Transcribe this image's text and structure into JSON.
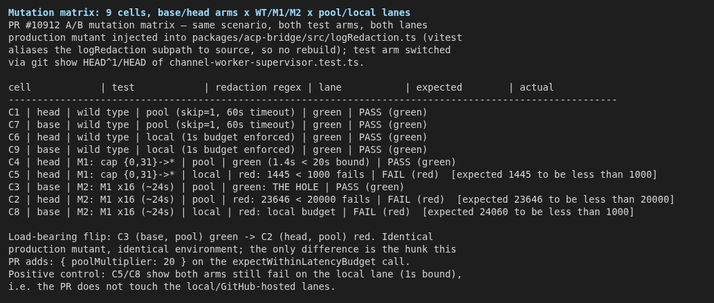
{
  "title": "Mutation matrix: 9 cells, base/head arms x WT/M1/M2 x pool/local lanes",
  "intro": [
    "PR #10912 A/B mutation matrix — same scenario, both test arms, both lanes",
    "production mutant injected into packages/acp-bridge/src/logRedaction.ts (vitest",
    "aliases the logRedaction subpath to source, so no rebuild); test arm switched",
    "via git show HEAD^1/HEAD of channel-worker-supervisor.test.ts."
  ],
  "table": {
    "header": "cell            | test            | redaction regex | lane           | expected        | actual",
    "separator": "----------------------------------------------------------------------------------------------------------",
    "rows": [
      "C1 | head | wild type | pool (skip=1, 60s timeout) | green | PASS (green)",
      "C7 | base | wild type | pool (skip=1, 60s timeout) | green | PASS (green)",
      "C6 | head | wild type | local (1s budget enforced) | green | PASS (green)",
      "C9 | base | wild type | local (1s budget enforced) | green | PASS (green)",
      "C4 | head | M1: cap {0,31}->* | pool | green (1.4s < 20s bound) | PASS (green)",
      "C5 | head | M1: cap {0,31}->* | local | red: 1445 < 1000 fails | FAIL (red)  [expected 1445 to be less than 1000]",
      "C3 | base | M2: M1 x16 (~24s) | pool | green: THE HOLE | PASS (green)",
      "C2 | head | M2: M1 x16 (~24s) | pool | red: 23646 < 20000 fails | FAIL (red)  [expected 23646 to be less than 20000]",
      "C8 | base | M2: M1 x16 (~24s) | local | red: local budget | FAIL (red)  [expected 24060 to be less than 1000]"
    ]
  },
  "conclusion": [
    "Load-bearing flip: C3 (base, pool) green -> C2 (head, pool) red. Identical",
    "production mutant, identical environment; the only difference is the hunk this",
    "PR adds: { poolMultiplier: 20 } on the expectWithinLatencyBudget call.",
    "Positive control: C5/C8 show both arms still fail on the local lane (1s bound),",
    "i.e. the PR does not touch the local/GitHub-hosted lanes."
  ]
}
